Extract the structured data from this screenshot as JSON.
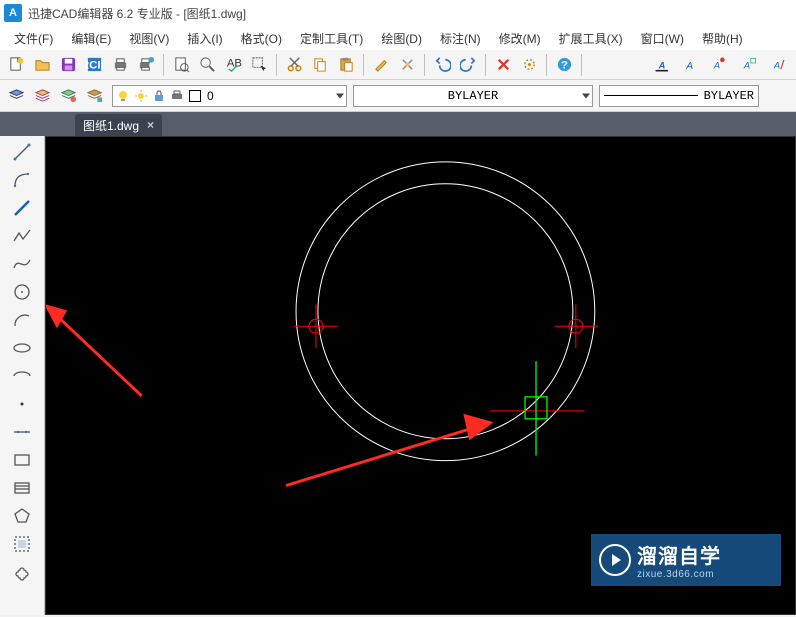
{
  "title": "迅捷CAD编辑器 6.2 专业版  - [图纸1.dwg]",
  "menu": [
    "文件(F)",
    "编辑(E)",
    "视图(V)",
    "插入(I)",
    "格式(O)",
    "定制工具(T)",
    "绘图(D)",
    "标注(N)",
    "修改(M)",
    "扩展工具(X)",
    "窗口(W)",
    "帮助(H)"
  ],
  "tab": {
    "label": "图纸1.dwg",
    "close": "×"
  },
  "combos": {
    "layer_value": "0",
    "color_value": "BYLAYER",
    "linetype_value": "BYLAYER"
  },
  "watermark": {
    "big": "溜溜自学",
    "small": "zixue.3d66.com"
  }
}
